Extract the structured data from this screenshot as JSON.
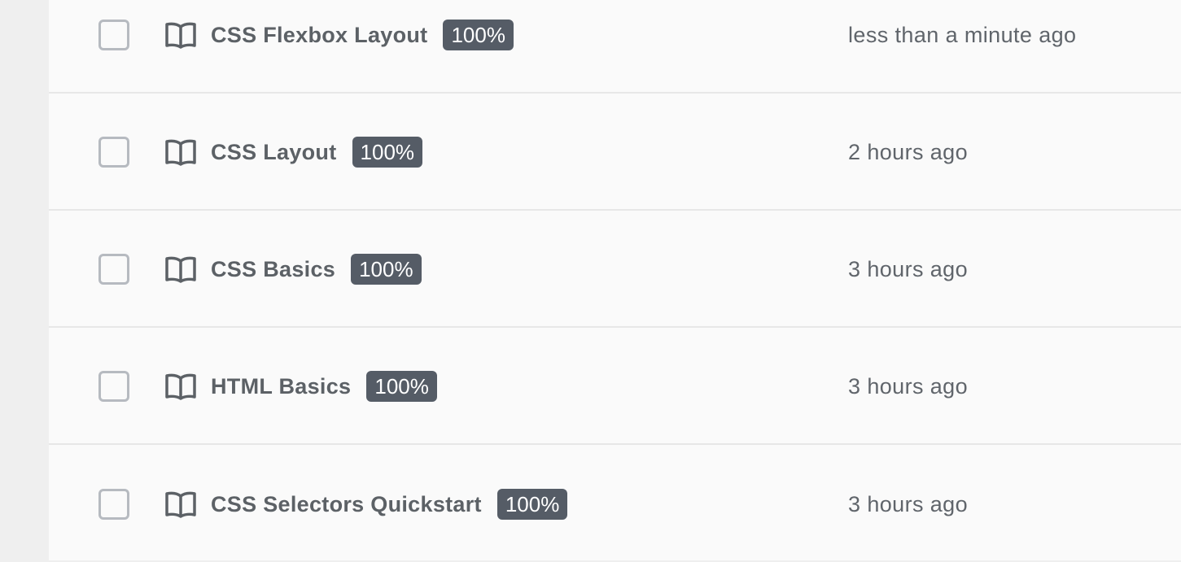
{
  "items": [
    {
      "title": "CSS Flexbox Layout",
      "progress": "100%",
      "updated": "less than a minute ago"
    },
    {
      "title": "CSS Layout",
      "progress": "100%",
      "updated": "2 hours ago"
    },
    {
      "title": "CSS Basics",
      "progress": "100%",
      "updated": "3 hours ago"
    },
    {
      "title": "HTML Basics",
      "progress": "100%",
      "updated": "3 hours ago"
    },
    {
      "title": "CSS Selectors Quickstart",
      "progress": "100%",
      "updated": "3 hours ago"
    }
  ],
  "icons": {
    "item_type": "book-icon",
    "select": "checkbox"
  },
  "colors": {
    "badge_bg": "#555c66",
    "text": "#5c6166",
    "background": "#fafafa"
  }
}
